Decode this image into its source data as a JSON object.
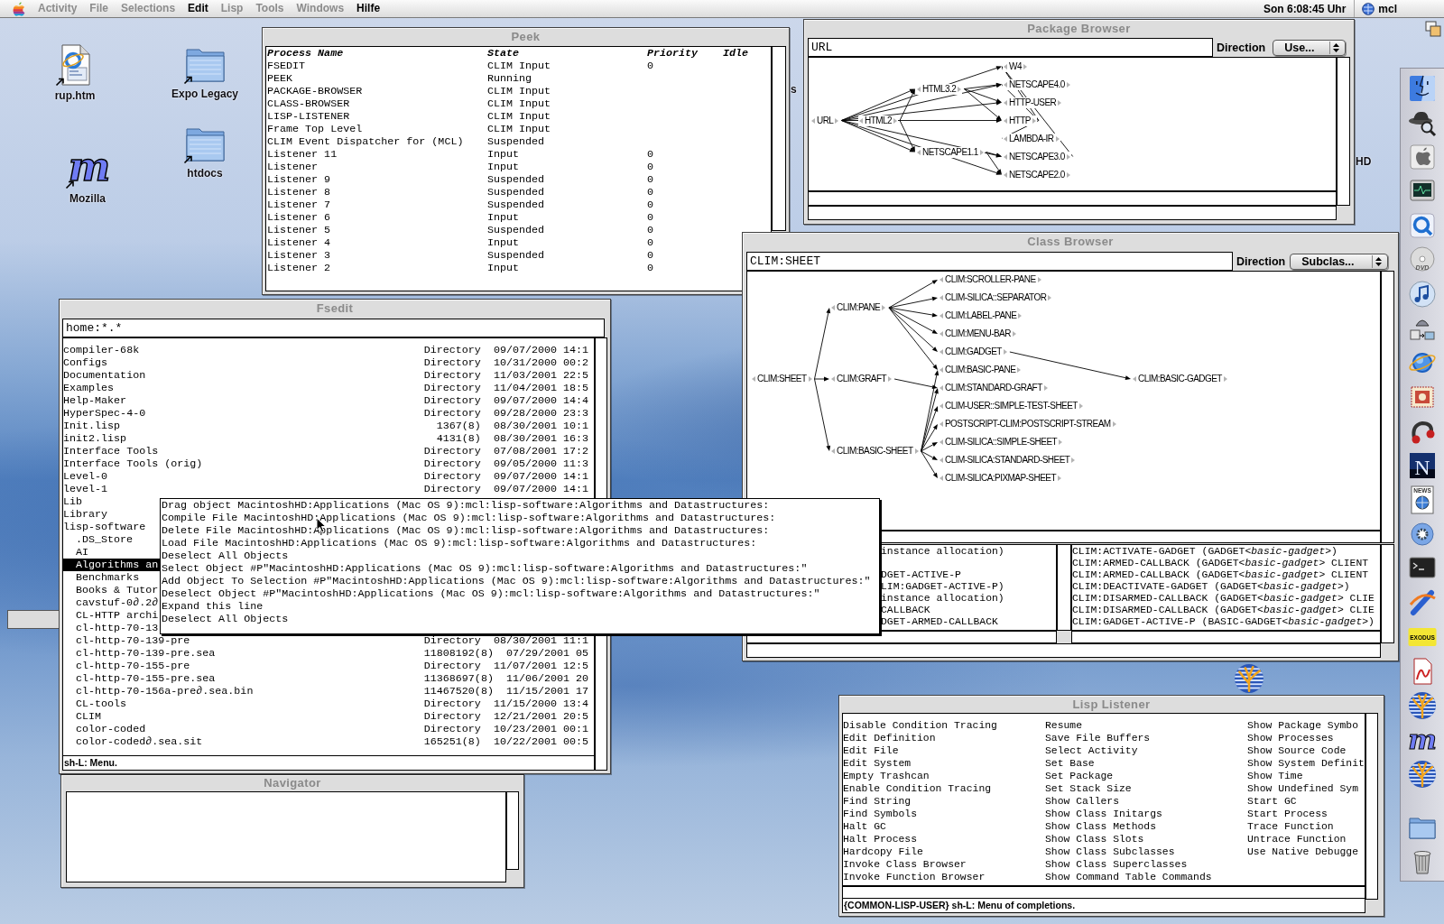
{
  "menu_bar": {
    "items": [
      {
        "label": "Activity",
        "disabled": true
      },
      {
        "label": "File",
        "disabled": true
      },
      {
        "label": "Selections",
        "disabled": true
      },
      {
        "label": "Edit",
        "disabled": false
      },
      {
        "label": "Lisp",
        "disabled": true
      },
      {
        "label": "Tools",
        "disabled": true
      },
      {
        "label": "Windows",
        "disabled": true
      },
      {
        "label": "Hilfe",
        "disabled": false
      }
    ],
    "clock": "Son 6:08:45 Uhr",
    "user": "mcl"
  },
  "desktop": {
    "icons": [
      {
        "label": "rup.htm",
        "kind": "document"
      },
      {
        "label": "Expo Legacy",
        "kind": "folder"
      },
      {
        "label": "htdocs",
        "kind": "folder"
      },
      {
        "label": "Mozilla",
        "kind": "logo",
        "glyph": "m"
      }
    ],
    "partial_labels": [
      "s",
      "HD"
    ]
  },
  "peek": {
    "title": "Peek",
    "columns": [
      "Process Name",
      "State",
      "Priority",
      "Idle"
    ],
    "rows": [
      {
        "name": "FSEDIT",
        "state": "CLIM Input",
        "priority": "0"
      },
      {
        "name": "PEEK",
        "state": "Running"
      },
      {
        "name": "PACKAGE-BROWSER",
        "state": "CLIM Input"
      },
      {
        "name": "CLASS-BROWSER",
        "state": "CLIM Input"
      },
      {
        "name": "LISP-LISTENER",
        "state": "CLIM Input"
      },
      {
        "name": "Frame Top Level",
        "state": "CLIM Input"
      },
      {
        "name": "CLIM Event Dispatcher for (MCL)",
        "state": "Suspended"
      },
      {
        "name": "Listener 11",
        "state": "Input",
        "priority": "0"
      },
      {
        "name": "Listener",
        "state": "Input",
        "priority": "0"
      },
      {
        "name": "Listener 9",
        "state": "Suspended",
        "priority": "0"
      },
      {
        "name": "Listener 8",
        "state": "Suspended",
        "priority": "0"
      },
      {
        "name": "Listener 7",
        "state": "Suspended",
        "priority": "0"
      },
      {
        "name": "Listener 6",
        "state": "Input",
        "priority": "0"
      },
      {
        "name": "Listener 5",
        "state": "Suspended",
        "priority": "0"
      },
      {
        "name": "Listener 4",
        "state": "Input",
        "priority": "0"
      },
      {
        "name": "Listener 3",
        "state": "Suspended",
        "priority": "0"
      },
      {
        "name": "Listener 2",
        "state": "Input",
        "priority": "0"
      }
    ]
  },
  "package_browser": {
    "title": "Package Browser",
    "query": "URL",
    "direction_label": "Direction",
    "direction": "Use...",
    "nodes": [
      "URL",
      "HTML2",
      "HTML3.2",
      "NETSCAPE1.1",
      "W4",
      "NETSCAPE4.0",
      "HTTP-USER",
      "HTTP",
      "LAMBDA-IR",
      "NETSCAPE3.0",
      "NETSCAPE2.0"
    ]
  },
  "class_browser": {
    "title": "Class Browser",
    "query": "CLIM:SHEET",
    "direction_label": "Direction",
    "direction": "Subclas...",
    "nodes": [
      "CLIM:SHEET",
      "CLIM:PANE",
      "CLIM:GRAFT",
      "CLIM:BASIC-SHEET",
      "CLIM:SCROLLER-PANE",
      "CLIM-SILICA::SEPARATOR",
      "CLIM:LABEL-PANE",
      "CLIM:MENU-BAR",
      "CLIM:GADGET",
      "CLIM:BASIC-PANE",
      "CLIM:STANDARD-GRAFT",
      "CLIM-USER::SIMPLE-TEST-SHEET",
      "POSTSCRIPT-CLIM:POSTSCRIPT-STREAM",
      "CLIM-SILICA::SIMPLE-SHEET",
      "CLIM-SILICA:STANDARD-SHEET",
      "CLIM-SILICA:PIXMAP-SHEET",
      "CLIM:BASIC-GADGET"
    ],
    "left_pane_lines": [
      "instance allocation)",
      "DGET-ACTIVE-P",
      "LIM:GADGET-ACTIVE-P)",
      "instance allocation)",
      "CALLBACK",
      "DGET-ARMED-CALLBACK"
    ],
    "right_pane_lines": [
      "CLIM:ACTIVATE-GADGET (GADGET<*basic-gadget*>)",
      "CLIM:ARMED-CALLBACK (GADGET<*basic-gadget*> CLIENT",
      "CLIM:ARMED-CALLBACK (GADGET<*basic-gadget*> CLIENT",
      "CLIM:DEACTIVATE-GADGET (GADGET<*basic-gadget*>)",
      "CLIM:DISARMED-CALLBACK (GADGET<*basic-gadget*> CLIE",
      "CLIM:DISARMED-CALLBACK (GADGET<*basic-gadget*> CLIE",
      "CLIM:GADGET-ACTIVE-P (BASIC-GADGET<*basic-gadget*>)"
    ]
  },
  "fsedit": {
    "title": "Fsedit",
    "path": "home:*.*",
    "files": [
      {
        "name": "compiler-68k",
        "info": "Directory",
        "date": "09/07/2000 14:1",
        "selected": false
      },
      {
        "name": "Configs",
        "info": "Directory",
        "date": "10/31/2000 00:2",
        "selected": false
      },
      {
        "name": "Documentation",
        "info": "Directory",
        "date": "11/03/2001 22:5",
        "selected": false
      },
      {
        "name": "Examples",
        "info": "Directory",
        "date": "11/04/2001 18:5",
        "selected": false
      },
      {
        "name": "Help-Maker",
        "info": "Directory",
        "date": "09/07/2000 14:4",
        "selected": false
      },
      {
        "name": "HyperSpec-4-0",
        "info": "Directory",
        "date": "09/28/2000 23:3",
        "selected": false
      },
      {
        "name": "Init.lisp",
        "info": "1367(8)",
        "date": "08/30/2001 10:1",
        "selected": false
      },
      {
        "name": "init2.lisp",
        "info": "4131(8)",
        "date": "08/30/2001 16:3",
        "selected": false
      },
      {
        "name": "Interface Tools",
        "info": "Directory",
        "date": "07/08/2001 17:2",
        "selected": false
      },
      {
        "name": "Interface Tools (orig)",
        "info": "Directory",
        "date": "09/05/2000 11:3",
        "selected": false
      },
      {
        "name": "Level-0",
        "info": "Directory",
        "date": "09/07/2000 14:1",
        "selected": false
      },
      {
        "name": "level-1",
        "info": "Directory",
        "date": "09/07/2000 14:1",
        "selected": false
      },
      {
        "name": "Lib",
        "selected": false
      },
      {
        "name": "Library",
        "selected": false
      },
      {
        "name": "lisp-software",
        "selected": false,
        "children": [
          {
            "name": ".DS_Store",
            "selected": false
          },
          {
            "name": "AI",
            "selected": false
          },
          {
            "name": "Algorithms an",
            "selected": true
          },
          {
            "name": "Benchmarks",
            "selected": false
          },
          {
            "name": "Books & Tutor",
            "selected": false
          },
          {
            "name": "cavstuf-0∂.2∂",
            "selected": false
          },
          {
            "name": "CL-HTTP archi",
            "selected": false
          },
          {
            "name": "cl-http-70-13",
            "selected": false
          },
          {
            "name": "cl-http-70-139-pre",
            "info": "Directory",
            "date": "08/30/2001 11:1",
            "selected": false
          },
          {
            "name": "cl-http-70-139-pre.sea",
            "info": "11808192(8)",
            "date": "07/29/2001 05",
            "selected": false
          },
          {
            "name": "cl-http-70-155-pre",
            "info": "Directory",
            "date": "11/07/2001 12:5",
            "selected": false
          },
          {
            "name": "cl-http-70-155-pre.sea",
            "info": "11368697(8)",
            "date": "11/06/2001 20",
            "selected": false
          },
          {
            "name": "cl-http-70-156a-pre∂.sea.bin",
            "info": "11467520(8)",
            "date": "11/15/2001 17",
            "selected": false
          },
          {
            "name": "CL-tools",
            "info": "Directory",
            "date": "11/15/2000 13:4",
            "selected": false
          },
          {
            "name": "CLIM",
            "info": "Directory",
            "date": "12/21/2001 20:5",
            "selected": false
          },
          {
            "name": "color-coded",
            "info": "Directory",
            "date": "10/23/2001 00:1",
            "selected": false
          },
          {
            "name": "color-coded∂.sea.sit",
            "info": "165251(8)",
            "date": "10/22/2001 00:5",
            "selected": false
          }
        ]
      }
    ],
    "status": "sh-L: Menu."
  },
  "context_menu": {
    "items": [
      "Drag object MacintoshHD:Applications (Mac OS 9):mcl:lisp-software:Algorithms and Datastructures:",
      "Compile File MacintoshHD:Applications (Mac OS 9):mcl:lisp-software:Algorithms and Datastructures:",
      "Delete File MacintoshHD:Applications (Mac OS 9):mcl:lisp-software:Algorithms and Datastructures:",
      "Load File MacintoshHD:Applications (Mac OS 9):mcl:lisp-software:Algorithms and Datastructures:",
      "Deselect All Objects",
      "Select Object #P\"MacintoshHD:Applications (Mac OS 9):mcl:lisp-software:Algorithms and Datastructures:\"",
      "Add Object To Selection #P\"MacintoshHD:Applications (Mac OS 9):mcl:lisp-software:Algorithms and Datastructures:\"",
      "Deselect Object #P\"MacintoshHD:Applications (Mac OS 9):mcl:lisp-software:Algorithms and Datastructures:\"",
      "Expand this line",
      "Deselect All Objects"
    ]
  },
  "navigator": {
    "title": "Navigator"
  },
  "lisp_listener": {
    "title": "Lisp Listener",
    "columns": [
      {
        "commands": [
          "Disable Condition Tracing",
          "Edit Definition",
          "Edit File",
          "Edit System",
          "Empty Trashcan",
          "Enable Condition Tracing",
          "Find String",
          "Find Symbols",
          "Halt GC",
          "Halt Process",
          "Hardcopy File",
          "Invoke Class Browser",
          "Invoke Function Browser"
        ]
      },
      {
        "commands": [
          "Resume",
          "Save File Buffers",
          "Select Activity",
          "Set Base",
          "Set Package",
          "Set Stack Size",
          "Show Callers",
          "Show Class Initargs",
          "Show Class Methods",
          "Show Class Slots",
          "Show Class Subclasses",
          "Show Class Superclasses",
          "Show Command Table Commands"
        ]
      },
      {
        "commands": [
          "Show Package Symbo",
          "Show Processes",
          "Show Source Code",
          "Show System Definit",
          "Show Time",
          "Show Undefined Sym",
          "Start GC",
          "Start Process",
          "Trace Function",
          "Untrace Function",
          "Use Native Debugge"
        ]
      }
    ],
    "status": "{COMMON-LISP-USER} sh-L: Menu of completions."
  },
  "dock": {
    "items": [
      {
        "kind": "face"
      },
      {
        "kind": "hat"
      },
      {
        "kind": "apple"
      },
      {
        "kind": "monitor"
      },
      {
        "kind": "ring"
      },
      {
        "kind": "disc",
        "glyph": "DVD"
      },
      {
        "kind": "note"
      },
      {
        "kind": "device"
      },
      {
        "kind": "globe"
      },
      {
        "kind": "stamp"
      },
      {
        "kind": "clamp"
      },
      {
        "kind": "letter",
        "glyph": "N"
      },
      {
        "kind": "news",
        "glyph": "NEWS"
      },
      {
        "kind": "gear"
      },
      {
        "kind": "terminal"
      },
      {
        "kind": "swoosh"
      },
      {
        "kind": "badge",
        "glyph": "EXODUS"
      },
      {
        "kind": "document"
      },
      {
        "kind": "tree"
      },
      {
        "kind": "logo",
        "glyph": "m"
      },
      {
        "kind": "tree"
      },
      {
        "kind": "folder"
      },
      {
        "kind": "trash"
      }
    ]
  }
}
